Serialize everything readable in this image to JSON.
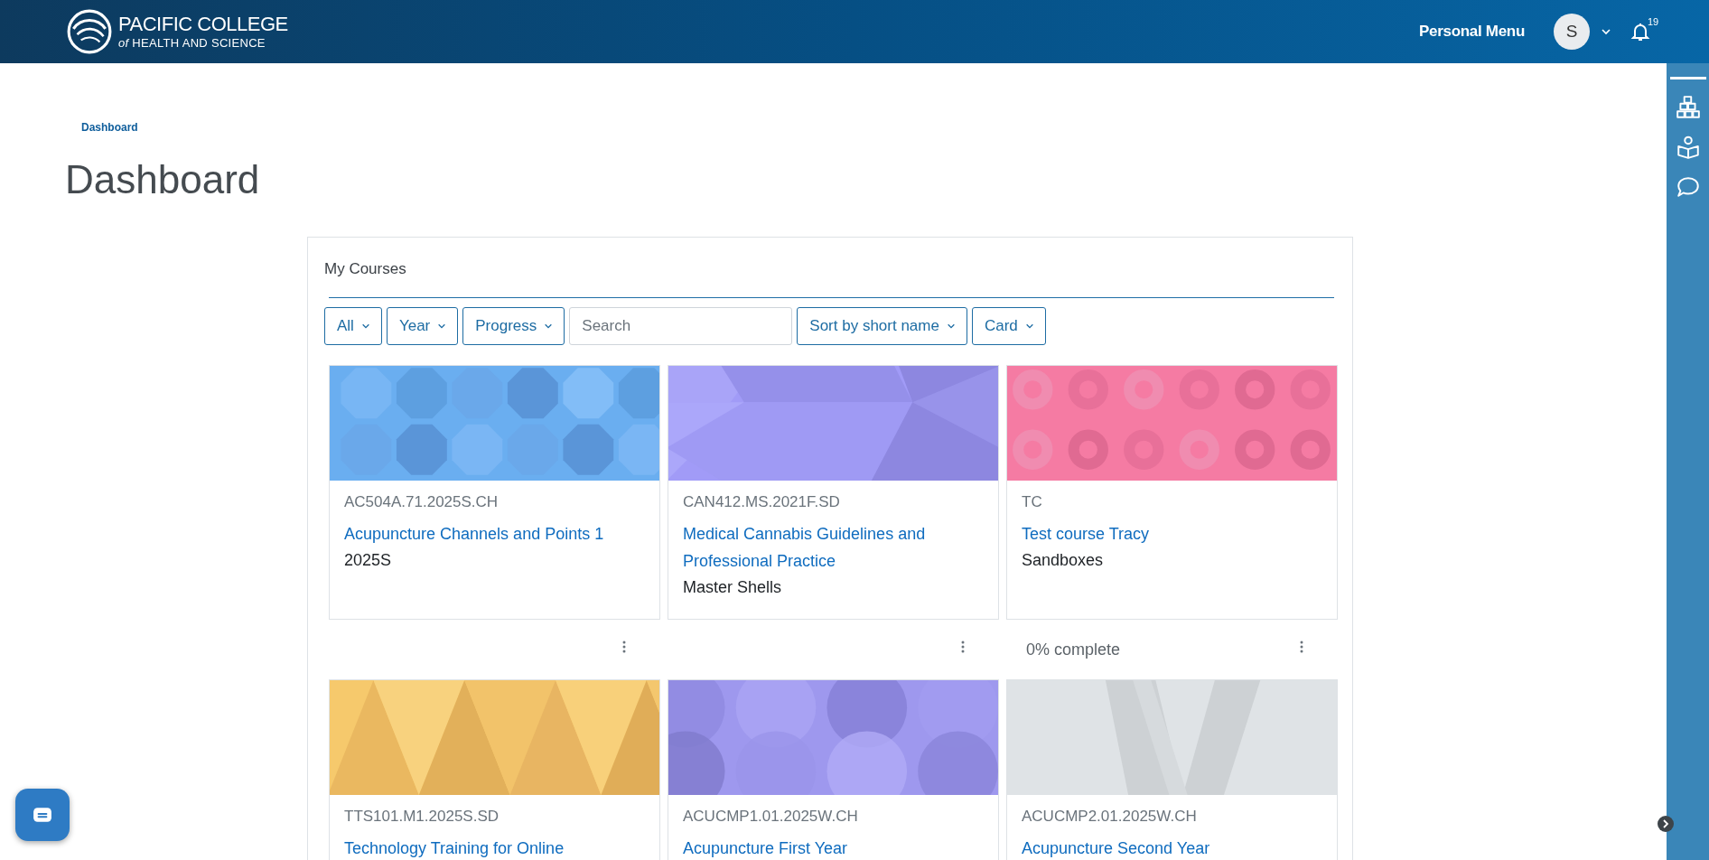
{
  "header": {
    "logo_title": "PACIFIC COLLEGE",
    "logo_subtitle": "*of* HEALTH AND SCIENCE",
    "user_menu": "Personal Menu",
    "avatar": "S",
    "notification_count": "19"
  },
  "breadcrumb": [
    "Dashboard"
  ],
  "page_title": "Dashboard",
  "my_courses": {
    "title": "My Courses",
    "filters": [
      {
        "kind": "dropdown",
        "label": "All"
      },
      {
        "kind": "dropdown",
        "label": "Year"
      },
      {
        "kind": "dropdown",
        "label": "Progress"
      },
      {
        "kind": "search",
        "placeholder": "Search"
      },
      {
        "kind": "dropdown",
        "label": "Sort by short name"
      },
      {
        "kind": "dropdown",
        "label": "Card"
      }
    ],
    "courses": [
      {
        "shortname": "AC504A.71.2025S.CH",
        "name": "Acupuncture Channels and Points 1",
        "category": "2025S"
      },
      {
        "shortname": "CAN412.MS.2021F.SD",
        "name": "Medical Cannabis Guidelines and Professional Practice",
        "category": "Master Shells"
      },
      {
        "shortname": "TC",
        "name": "Test course Tracy",
        "category": "Sandboxes",
        "progress": "0% complete"
      },
      {
        "shortname": "TTS101.M1.2025S.SD",
        "name": "Technology Training for Online"
      },
      {
        "shortname": "ACUCMP1.01.2025W.CH",
        "name": "Acupuncture First Year"
      },
      {
        "shortname": "ACUCMP2.01.2025W.CH",
        "name": "Acupuncture Second Year"
      }
    ]
  }
}
